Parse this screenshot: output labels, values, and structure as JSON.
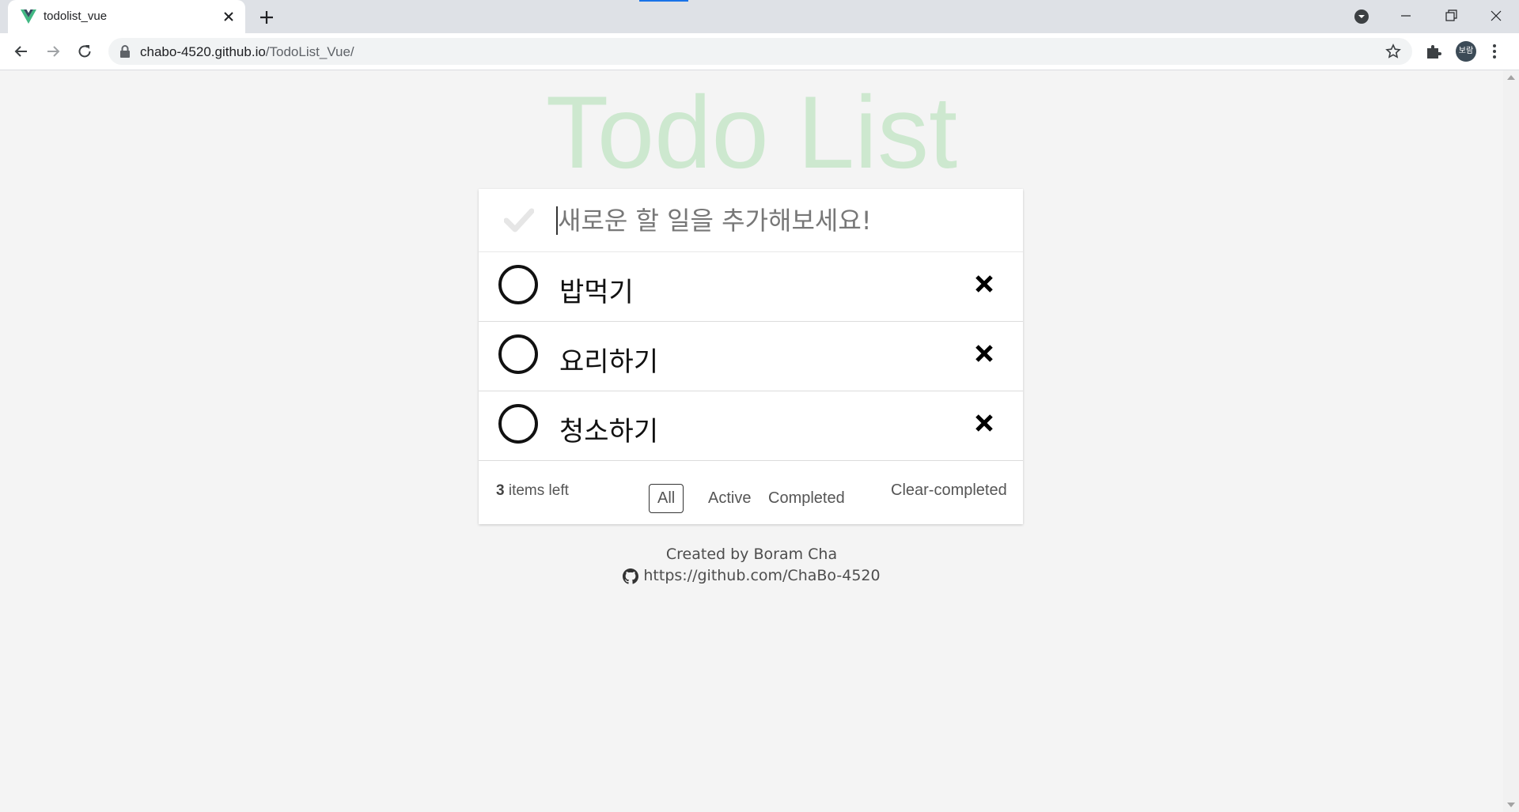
{
  "browser": {
    "tab_title": "todolist_vue",
    "url_host": "chabo-4520.github.io",
    "url_path": "/TodoList_Vue/",
    "profile_initials": "보람"
  },
  "app": {
    "title": "Todo List",
    "input_placeholder": "새로운 할 일을 추가해보세요!",
    "todos": [
      {
        "text": "밥먹기",
        "completed": false
      },
      {
        "text": "요리하기",
        "completed": false
      },
      {
        "text": "청소하기",
        "completed": false
      }
    ],
    "footer": {
      "count": "3",
      "count_suffix": "items left",
      "filters": [
        "All",
        "Active",
        "Completed"
      ],
      "selected_filter": "All",
      "clear_label": "Clear-completed"
    },
    "credit": {
      "author": "Created by Boram Cha",
      "link": "https://github.com/ChaBo-4520"
    }
  },
  "colors": {
    "title": "#cde8cf",
    "background": "#f4f4f4",
    "vue_green": "#41b883",
    "vue_dark": "#35495e"
  }
}
